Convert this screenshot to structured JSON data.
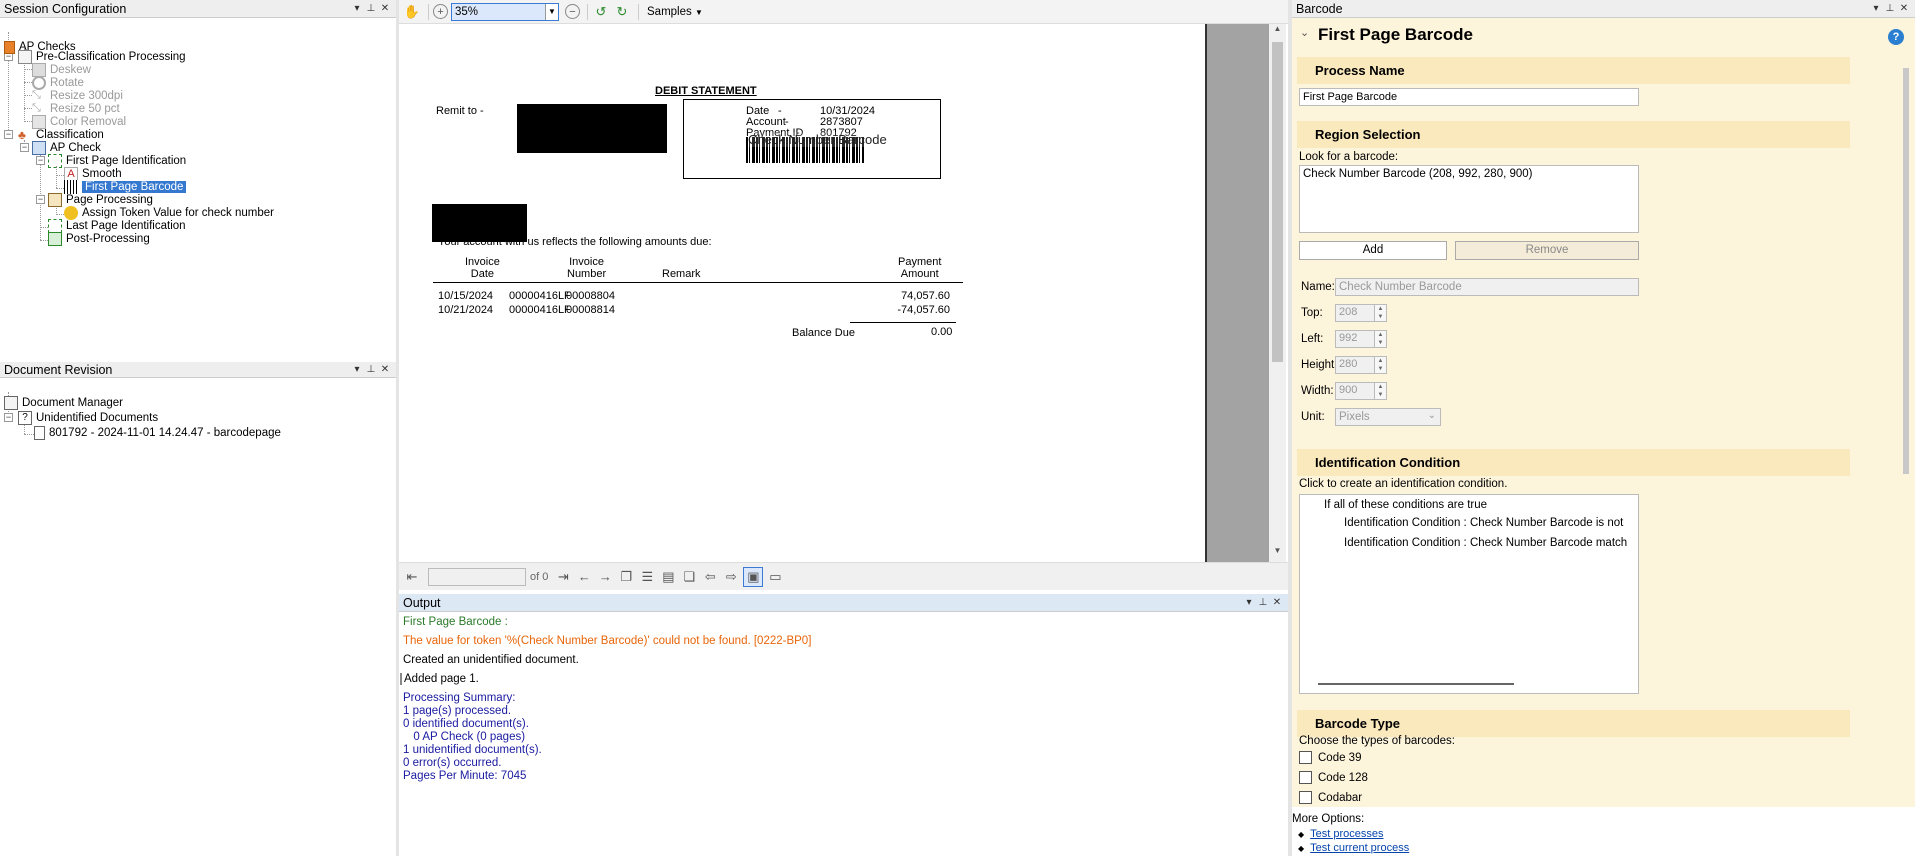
{
  "session": {
    "title": "Session Configuration",
    "root": "AP Checks",
    "pre": "Pre-Classification Processing",
    "pre_items": [
      "Deskew",
      "Rotate",
      "Resize 300dpi",
      "Resize 50 pct",
      "Color Removal"
    ],
    "classification": "Classification",
    "ap_check": "AP Check",
    "first_page_id": "First Page Identification",
    "smooth": "Smooth",
    "first_page_barcode": "First Page Barcode",
    "page_processing": "Page Processing",
    "assign_token": "Assign Token Value for check number",
    "last_page_id": "Last Page Identification",
    "post_processing": "Post-Processing"
  },
  "revision": {
    "title": "Document Revision",
    "manager": "Document Manager",
    "unidentified": "Unidentified Documents",
    "doc": "801792 - 2024-11-01 14.24.47 - barcodepage"
  },
  "viewer": {
    "zoom": "35%",
    "samples": "Samples",
    "page_of": "of 0"
  },
  "statement": {
    "title": "DEBIT STATEMENT",
    "remit": "Remit to -",
    "date_label": "Date",
    "date_value": "10/31/2024",
    "account_label": "Account",
    "account_value": "2873807",
    "payment_label": "Payment ID",
    "payment_value": "801792",
    "barcode_text": "Check Number Barcode",
    "intro": "Your account with us reflects the following amounts due:",
    "col_invoice_date": "Invoice\nDate",
    "col_invoice_number": "Invoice\nNumber",
    "col_remark": "Remark",
    "col_payment_amount": "Payment\nAmount",
    "rows": [
      {
        "date": "10/15/2024",
        "ref": "00000416LF",
        "num": "00008804",
        "amount": "74,057.60"
      },
      {
        "date": "10/21/2024",
        "ref": "00000416LF",
        "num": "00008814",
        "amount": "-74,057.60"
      }
    ],
    "balance_label": "Balance Due",
    "balance_value": "0.00"
  },
  "output": {
    "title": "Output",
    "lines": [
      "First Page Barcode :",
      "The value for token '%(Check Number Barcode)' could not be found. [0222-BP0]",
      "Created an unidentified document.",
      "Added page 1.",
      "Processing Summary:",
      "1 page(s) processed.",
      "0 identified document(s).",
      "  0 AP Check (0 pages)",
      "1 unidentified document(s).",
      "0 error(s) occurred.",
      "Pages Per Minute: 7045"
    ]
  },
  "barcode": {
    "panel_title": "Barcode",
    "heading": "First Page Barcode",
    "process_name_hdr": "Process Name",
    "process_name_value": "First Page Barcode",
    "region_hdr": "Region Selection",
    "look_for": "Look for a barcode:",
    "region_item": "Check Number Barcode (208, 992, 280, 900)",
    "add": "Add",
    "remove": "Remove",
    "name_label": "Name:",
    "name_value": "Check Number Barcode",
    "top_label": "Top:",
    "top_value": "208",
    "left_label": "Left:",
    "left_value": "992",
    "height_label": "Height:",
    "height_value": "280",
    "width_label": "Width:",
    "width_value": "900",
    "unit_label": "Unit:",
    "unit_value": "Pixels",
    "ident_hdr": "Identification Condition",
    "ident_hint": "Click to create an identification condition.",
    "cond_root": "If all of these conditions are true",
    "cond_1": "Identification Condition : Check Number Barcode is not",
    "cond_2": "Identification Condition : Check Number Barcode match",
    "type_hdr": "Barcode Type",
    "type_hint": "Choose the types of barcodes:",
    "types": [
      "Code 39",
      "Code 128",
      "Codabar"
    ],
    "more_options": "More Options:",
    "link_test": "Test processes",
    "link_current": "Test current process"
  },
  "colors": {
    "selection": "#3478d0",
    "error": "#e8650a",
    "success": "#2a7a2a",
    "summary": "#1a1aa0",
    "panel_bg": "#fdf4dc",
    "section_bg": "#fae9bd"
  }
}
